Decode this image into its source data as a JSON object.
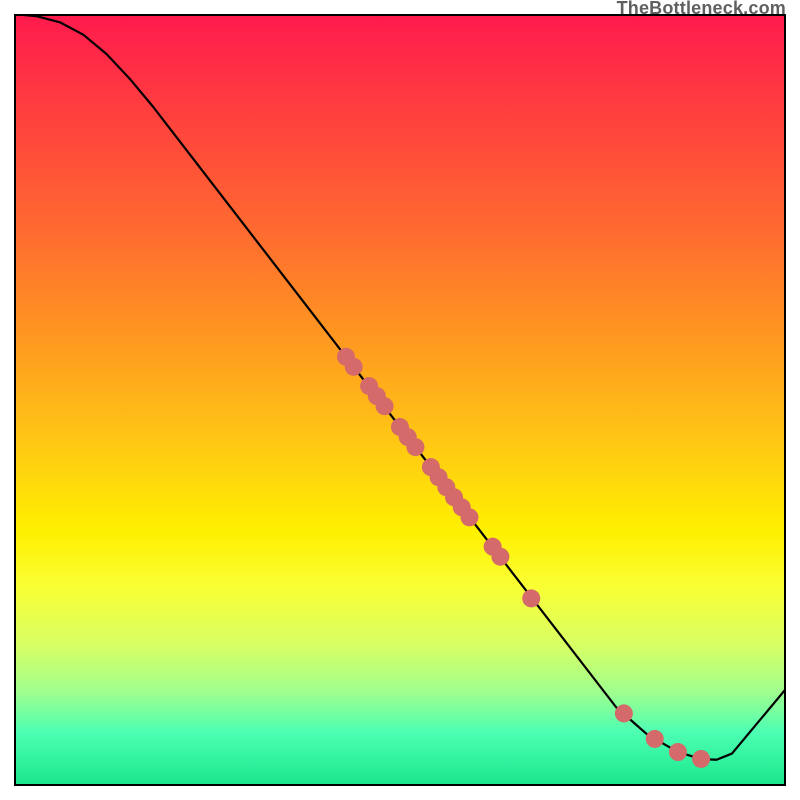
{
  "watermark": "TheBottleneck.com",
  "chart_data": {
    "type": "line",
    "title": "",
    "xlabel": "",
    "ylabel": "",
    "xlim": [
      0,
      100
    ],
    "ylim": [
      0,
      100
    ],
    "line": {
      "name": "bottleneck-curve",
      "points": [
        {
          "x": 0.0,
          "y": 100.0
        },
        {
          "x": 3.0,
          "y": 99.7
        },
        {
          "x": 6.0,
          "y": 98.9
        },
        {
          "x": 9.0,
          "y": 97.3
        },
        {
          "x": 12.0,
          "y": 94.8
        },
        {
          "x": 15.0,
          "y": 91.6
        },
        {
          "x": 18.0,
          "y": 88.0
        },
        {
          "x": 78.0,
          "y": 10.2
        },
        {
          "x": 82.0,
          "y": 6.7
        },
        {
          "x": 86.0,
          "y": 4.4
        },
        {
          "x": 89.0,
          "y": 3.5
        },
        {
          "x": 91.0,
          "y": 3.4
        },
        {
          "x": 93.0,
          "y": 4.2
        },
        {
          "x": 100.0,
          "y": 12.6
        }
      ]
    },
    "markers": {
      "name": "data-points",
      "color": "#d46a6a",
      "radius": 9,
      "points": [
        {
          "x": 43.0,
          "y": 55.6
        },
        {
          "x": 44.0,
          "y": 54.3
        },
        {
          "x": 46.0,
          "y": 51.8
        },
        {
          "x": 47.0,
          "y": 50.5
        },
        {
          "x": 48.0,
          "y": 49.2
        },
        {
          "x": 50.0,
          "y": 46.5
        },
        {
          "x": 51.0,
          "y": 45.2
        },
        {
          "x": 52.0,
          "y": 43.9
        },
        {
          "x": 54.0,
          "y": 41.3
        },
        {
          "x": 55.0,
          "y": 40.0
        },
        {
          "x": 56.0,
          "y": 38.7
        },
        {
          "x": 57.0,
          "y": 37.4
        },
        {
          "x": 58.0,
          "y": 36.1
        },
        {
          "x": 59.0,
          "y": 34.8
        },
        {
          "x": 62.0,
          "y": 31.0
        },
        {
          "x": 63.0,
          "y": 29.7
        },
        {
          "x": 67.0,
          "y": 24.3
        },
        {
          "x": 79.0,
          "y": 9.4
        },
        {
          "x": 83.0,
          "y": 6.1
        },
        {
          "x": 86.0,
          "y": 4.4
        },
        {
          "x": 89.0,
          "y": 3.5
        }
      ]
    }
  }
}
